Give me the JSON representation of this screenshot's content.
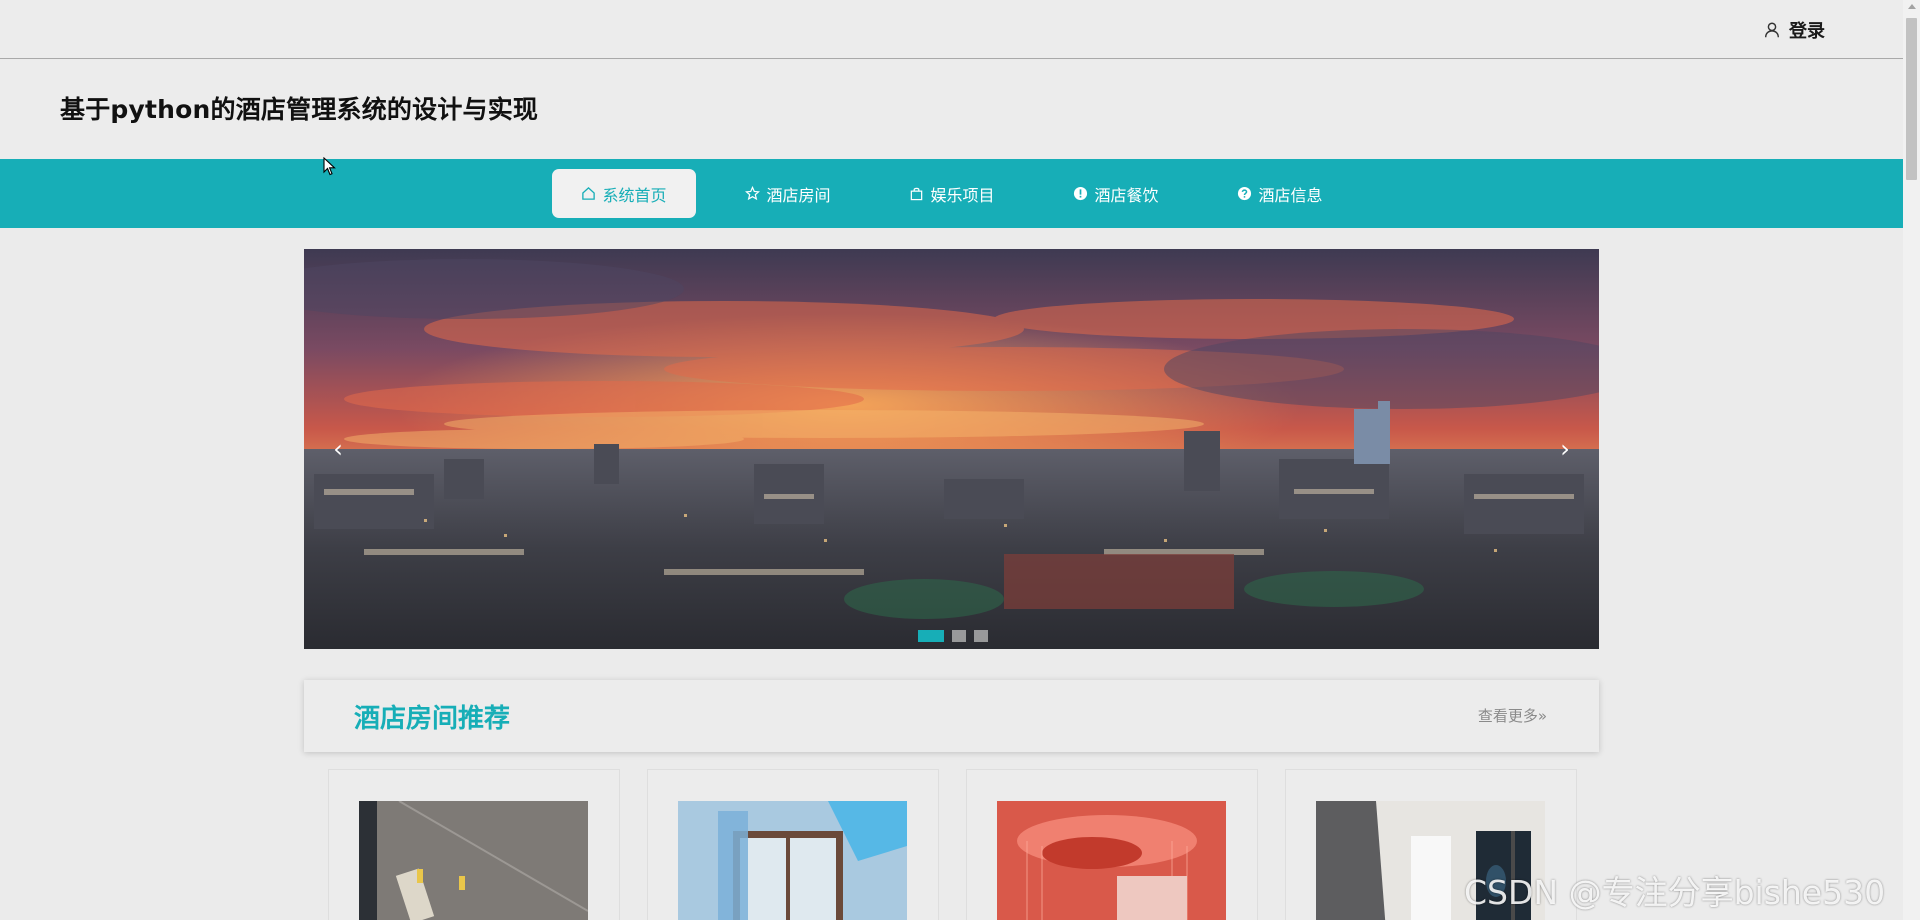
{
  "header": {
    "login_label": "登录"
  },
  "site": {
    "title": "基于python的酒店管理系统的设计与实现"
  },
  "nav": {
    "items": [
      {
        "label": "系统首页",
        "icon": "home-icon",
        "active": true
      },
      {
        "label": "酒店房间",
        "icon": "star-icon",
        "active": false
      },
      {
        "label": "娱乐项目",
        "icon": "bag-icon",
        "active": false
      },
      {
        "label": "酒店餐饮",
        "icon": "info-circle-icon",
        "active": false
      },
      {
        "label": "酒店信息",
        "icon": "question-circle-icon",
        "active": false
      }
    ]
  },
  "carousel": {
    "prev_label": "‹",
    "next_label": "›",
    "slide_count": 3,
    "active_slide": 1
  },
  "section": {
    "title": "酒店房间推荐",
    "more_label": "查看更多»"
  },
  "watermark": "CSDN @专注分享bishe530",
  "colors": {
    "accent": "#17aeb7",
    "background": "#ebebeb"
  }
}
